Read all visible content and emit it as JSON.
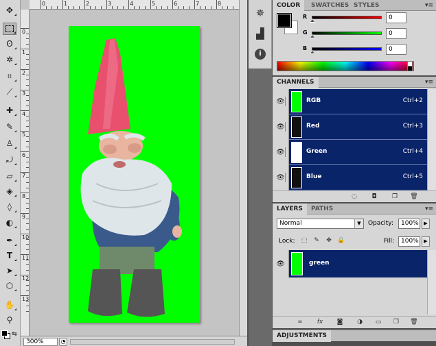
{
  "document": {
    "zoom": "300%",
    "ruler_top": [
      "0",
      "1",
      "2",
      "3",
      "4",
      "5",
      "6",
      "7",
      "8",
      "9"
    ],
    "ruler_left": [
      "0",
      "1",
      "2",
      "3",
      "4",
      "5",
      "6",
      "7",
      "8",
      "9",
      "10",
      "11",
      "12",
      "13"
    ]
  },
  "color_panel": {
    "tabs": [
      "COLOR",
      "SWATCHES",
      "STYLES"
    ],
    "sliders": [
      {
        "label": "R",
        "value": "0",
        "from": "#000000",
        "to": "#ff0000"
      },
      {
        "label": "G",
        "value": "0",
        "from": "#000000",
        "to": "#00ff00"
      },
      {
        "label": "B",
        "value": "0",
        "from": "#000000",
        "to": "#0000ff"
      }
    ]
  },
  "channels_panel": {
    "title": "CHANNELS",
    "rows": [
      {
        "name": "RGB",
        "shortcut": "Ctrl+2"
      },
      {
        "name": "Red",
        "shortcut": "Ctrl+3"
      },
      {
        "name": "Green",
        "shortcut": "Ctrl+4"
      },
      {
        "name": "Blue",
        "shortcut": "Ctrl+5"
      }
    ]
  },
  "layers_panel": {
    "tabs": [
      "LAYERS",
      "PATHS"
    ],
    "blend_mode": "Normal",
    "opacity_label": "Opacity:",
    "opacity_value": "100%",
    "lock_label": "Lock:",
    "fill_label": "Fill:",
    "fill_value": "100%",
    "layer_name": "green"
  },
  "adjustments_panel": {
    "title": "ADJUSTMENTS"
  },
  "colors": {
    "canvas_green": "#00ff00",
    "selection_blue": "#0a246a",
    "panel_gray": "#d6d6d6"
  }
}
